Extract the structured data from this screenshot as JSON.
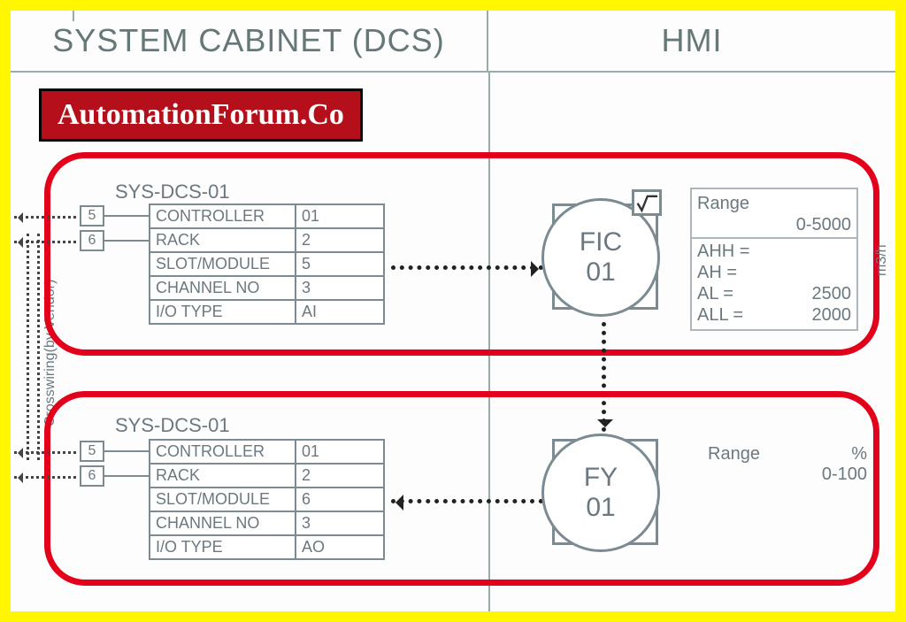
{
  "header": {
    "left": "SYSTEM CABINET (DCS)",
    "right": "HMI"
  },
  "banner": "AutomationForum.Co",
  "crosswiring_label": "Crosswiring(by Vendor)",
  "block1": {
    "sys": "SYS-DCS-01",
    "lead": {
      "a": "5",
      "b": "6"
    },
    "rows": [
      {
        "label": "CONTROLLER",
        "value": "01"
      },
      {
        "label": "RACK",
        "value": "2"
      },
      {
        "label": "SLOT/MODULE",
        "value": "5"
      },
      {
        "label": "CHANNEL NO",
        "value": "3"
      },
      {
        "label": "I/O TYPE",
        "value": "AI"
      }
    ],
    "instr": {
      "tag": "FIC",
      "num": "01"
    },
    "range": {
      "title": "Range",
      "span": "0-5000",
      "unit": "m3/h",
      "alarms": [
        {
          "k": "AHH =",
          "v": ""
        },
        {
          "k": "AH  =",
          "v": ""
        },
        {
          "k": "AL  =",
          "v": "2500"
        },
        {
          "k": "ALL =",
          "v": "2000"
        }
      ]
    }
  },
  "block2": {
    "sys": "SYS-DCS-01",
    "lead": {
      "a": "5",
      "b": "6"
    },
    "rows": [
      {
        "label": "CONTROLLER",
        "value": "01"
      },
      {
        "label": "RACK",
        "value": "2"
      },
      {
        "label": "SLOT/MODULE",
        "value": "6"
      },
      {
        "label": "CHANNEL NO",
        "value": "3"
      },
      {
        "label": "I/O TYPE",
        "value": "AO"
      }
    ],
    "instr": {
      "tag": "FY",
      "num": "01"
    },
    "range": {
      "title": "Range",
      "unit": "%",
      "span": "0-100"
    }
  }
}
